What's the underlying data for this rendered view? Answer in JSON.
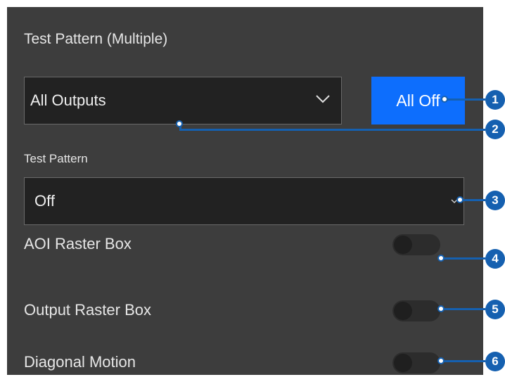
{
  "panel": {
    "title": "Test Pattern (Multiple)",
    "outputs_select": {
      "value": "All Outputs",
      "icon": "chevron-down-icon"
    },
    "all_off_button": "All Off",
    "test_pattern": {
      "label": "Test Pattern",
      "value": "Off",
      "icon": "chevron-down-icon"
    },
    "toggles": [
      {
        "label": "AOI Raster Box",
        "on": false
      },
      {
        "label": "Output Raster Box",
        "on": false
      },
      {
        "label": "Diagonal Motion",
        "on": false
      }
    ]
  },
  "callouts": [
    "1",
    "2",
    "3",
    "4",
    "5",
    "6"
  ],
  "colors": {
    "accent": "#0d6efd",
    "callout": "#1560b0",
    "panel_bg": "#3d3d3d"
  }
}
